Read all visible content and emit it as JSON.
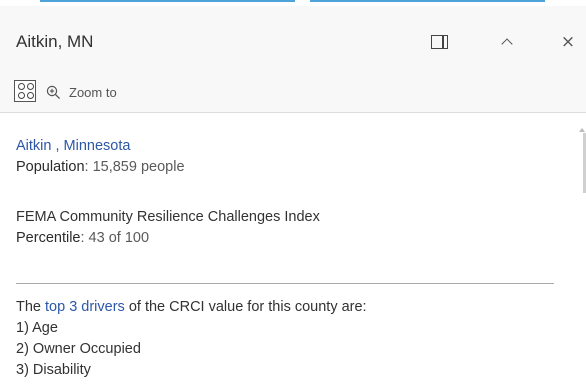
{
  "header": {
    "title": "Aitkin, MN"
  },
  "toolbar": {
    "zoom_label": "Zoom to"
  },
  "content": {
    "county_link": "Aitkin , Minnesota",
    "population_label": "Population",
    "population_value": ": 15,859",
    "population_unit": "people",
    "index_title": "FEMA Community Resilience Challenges Index",
    "percentile_label": "Percentile",
    "percentile_value": ": 43 of 100",
    "drivers_prefix": "The ",
    "drivers_link": "top 3 drivers",
    "drivers_suffix": " of the CRCI value for this county are:",
    "drivers": [
      "1) Age",
      "2) Owner Occupied",
      "3) Disability"
    ]
  },
  "colors": {
    "link": "#2c58a8",
    "text": "#323232",
    "header_bg": "#f8f8f8"
  },
  "icons": {
    "dock": "dock-icon",
    "collapse": "chevron-up-icon",
    "close": "close-icon",
    "menu": "feature-menu-icon",
    "zoom": "zoom-in-icon"
  }
}
